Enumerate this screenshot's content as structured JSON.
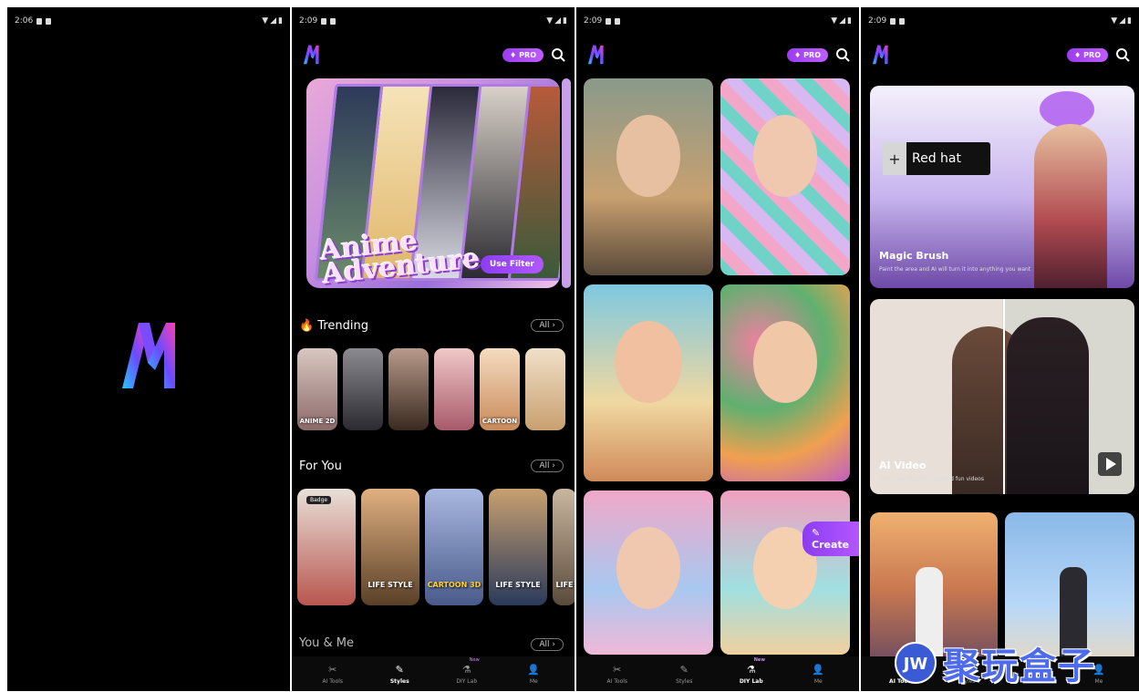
{
  "screens": [
    {
      "status_time": "2:06"
    },
    {
      "status_time": "2:09"
    },
    {
      "status_time": "2:09"
    },
    {
      "status_time": "2:09"
    }
  ],
  "header": {
    "pro_label": "PRO"
  },
  "hero": {
    "title_line1": "Anime",
    "title_line2": "Adventure",
    "button": "Use Filter"
  },
  "trending": {
    "title": "Trending",
    "all_label": "All",
    "items": [
      {
        "label": "ANIME 2D",
        "color": "#8c6a6a"
      },
      {
        "label": "",
        "color": "#4a4a52"
      },
      {
        "label": "",
        "color": "#5b4a3d"
      },
      {
        "label": "",
        "color": "#a86a7a"
      },
      {
        "label": "CARTOON",
        "color": "#c99a7a"
      },
      {
        "label": "",
        "color": "#cfa57a"
      }
    ]
  },
  "for_you": {
    "title": "For You",
    "all_label": "All",
    "items": [
      {
        "label": "",
        "badge": "Badge",
        "color": "#b8564f"
      },
      {
        "label": "LIFE STYLE",
        "color": "#7a5a3a"
      },
      {
        "label": "CARTOON 3D",
        "color": "#5a6a9a"
      },
      {
        "label": "LIFE STYLE",
        "color": "#4a5a7a"
      },
      {
        "label": "LIFE",
        "color": "#7a6a5a"
      }
    ]
  },
  "you_and_me": {
    "title": "You & Me",
    "all_label": "All"
  },
  "nav": {
    "items": [
      {
        "label": "AI Tools"
      },
      {
        "label": "Styles"
      },
      {
        "label": "DIY Lab",
        "badge": "New"
      },
      {
        "label": "Me"
      }
    ]
  },
  "diy": {
    "create_button": "Create"
  },
  "tools": {
    "magic_brush": {
      "title": "Magic Brush",
      "subtitle": "Paint the area and AI will turn it into anything you want",
      "tag": "Red hat"
    },
    "ai_video": {
      "title": "AI Video",
      "subtitle": "Turn your clips into stylized fun videos"
    }
  },
  "watermark": {
    "text": "聚玩盒子"
  },
  "colors": {
    "accent": "#a64dff",
    "background": "#000000"
  }
}
